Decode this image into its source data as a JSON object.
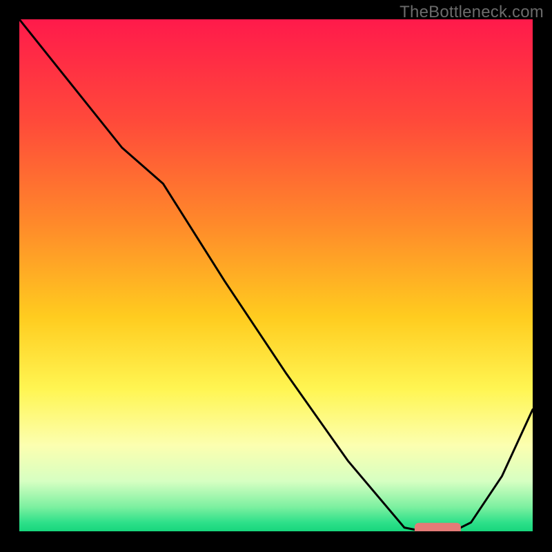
{
  "watermark": "TheBottleneck.com",
  "chart_data": {
    "type": "line",
    "title": "",
    "xlabel": "",
    "ylabel": "",
    "xlim": [
      0,
      100
    ],
    "ylim": [
      0,
      100
    ],
    "legend": false,
    "grid": false,
    "background_gradient": [
      {
        "stop": 0.0,
        "color": "#ff1a4b"
      },
      {
        "stop": 0.2,
        "color": "#ff4a3a"
      },
      {
        "stop": 0.4,
        "color": "#ff8a2a"
      },
      {
        "stop": 0.58,
        "color": "#ffcc1f"
      },
      {
        "stop": 0.72,
        "color": "#fff552"
      },
      {
        "stop": 0.83,
        "color": "#fcffb0"
      },
      {
        "stop": 0.9,
        "color": "#d6ffc2"
      },
      {
        "stop": 0.95,
        "color": "#7cf0a0"
      },
      {
        "stop": 0.98,
        "color": "#2ee08a"
      },
      {
        "stop": 1.0,
        "color": "#14d47a"
      }
    ],
    "series": [
      {
        "name": "bottleneck-curve",
        "stroke": "#000000",
        "x": [
          0,
          8,
          20,
          28,
          40,
          52,
          64,
          75,
          80,
          84,
          88,
          94,
          100
        ],
        "values": [
          100,
          90,
          75,
          68,
          49,
          31,
          14,
          1,
          0,
          0,
          2,
          11,
          24
        ]
      }
    ],
    "marker": {
      "name": "sweet-spot",
      "color": "#e47b77",
      "x_start": 77,
      "x_end": 86,
      "y": 0.5,
      "thickness": 2
    }
  }
}
